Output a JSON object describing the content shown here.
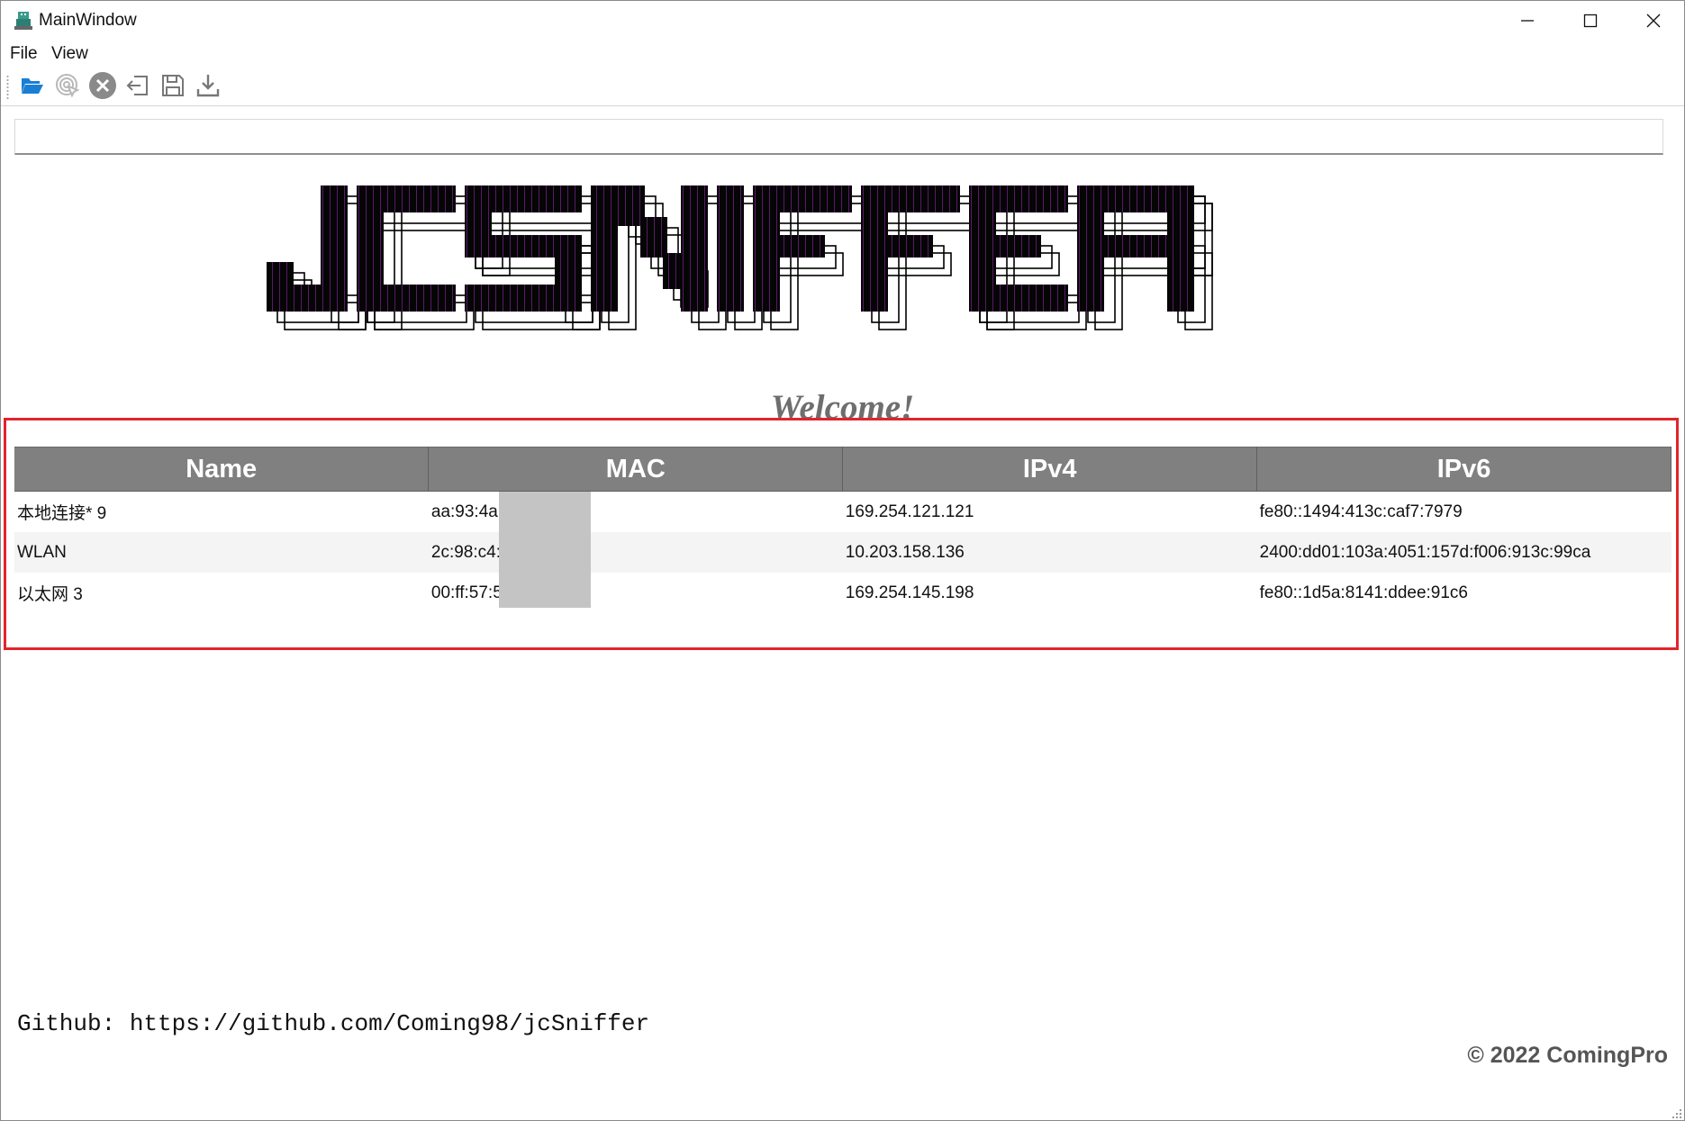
{
  "window": {
    "title": "MainWindow",
    "icons": {
      "app": "app-icon",
      "minimize": "minimize-icon",
      "maximize": "maximize-icon",
      "close": "close-icon"
    }
  },
  "menu": {
    "items": [
      "File",
      "View"
    ]
  },
  "toolbar": {
    "buttons": [
      {
        "icon": "folder-open-icon",
        "color": "#1a7fd4"
      },
      {
        "icon": "capture-start-icon",
        "color": "#b8b8b8"
      },
      {
        "icon": "stop-circle-icon",
        "color": "#8a8a8a"
      },
      {
        "icon": "exit-icon",
        "color": "#777777"
      },
      {
        "icon": "save-icon",
        "color": "#777777"
      },
      {
        "icon": "download-icon",
        "color": "#777777"
      }
    ]
  },
  "filter": {
    "value": "",
    "placeholder": ""
  },
  "logo": {
    "text": "JCSNIFFER"
  },
  "welcome": "Welcome!",
  "interfaces": {
    "columns": [
      "Name",
      "MAC",
      "IPv4",
      "IPv6"
    ],
    "rows": [
      {
        "name": "本地连接* 9",
        "mac": "aa:93:4a:",
        "ipv4": "169.254.121.121",
        "ipv6": "fe80::1494:413c:caf7:7979"
      },
      {
        "name": "WLAN",
        "mac": "2c:98:c4:",
        "ipv4": "10.203.158.136",
        "ipv6": "2400:dd01:103a:4051:157d:f006:913c:99ca"
      },
      {
        "name": "以太网 3",
        "mac": "00:ff:57:5",
        "ipv4": "169.254.145.198",
        "ipv6": "fe80::1d5a:8141:ddee:91c6"
      }
    ],
    "header_color": "#808080",
    "highlight_color": "#e2242c"
  },
  "footer": {
    "github": "Github: https://github.com/Coming98/jcSniffer",
    "copyright": "© 2022 ComingPro"
  }
}
